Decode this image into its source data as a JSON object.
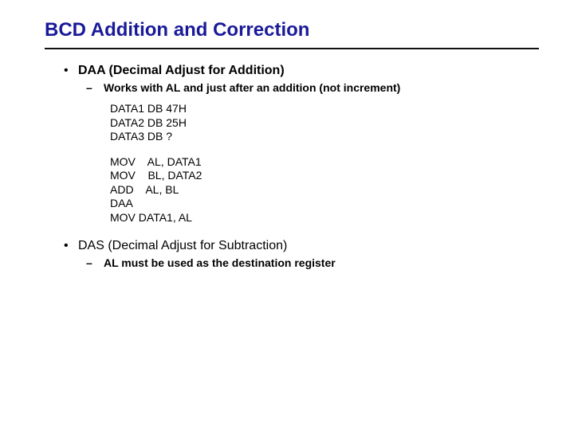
{
  "title": "BCD Addition and Correction",
  "items": [
    {
      "bullet": "•",
      "text": "DAA (Decimal Adjust for Addition)",
      "bold": true,
      "sub": [
        {
          "bullet": "–",
          "text": "Works with AL and just after an addition (not increment)"
        }
      ],
      "code1": "DATA1 DB 47H\nDATA2 DB 25H\nDATA3 DB ?",
      "code2": "MOV    AL, DATA1\nMOV    BL, DATA2\nADD    AL, BL\nDAA\nMOV DATA1, AL"
    },
    {
      "bullet": "•",
      "text": "DAS (Decimal Adjust for Subtraction)",
      "bold": false,
      "sub": [
        {
          "bullet": "–",
          "text": "AL must be used as the destination register"
        }
      ]
    }
  ]
}
